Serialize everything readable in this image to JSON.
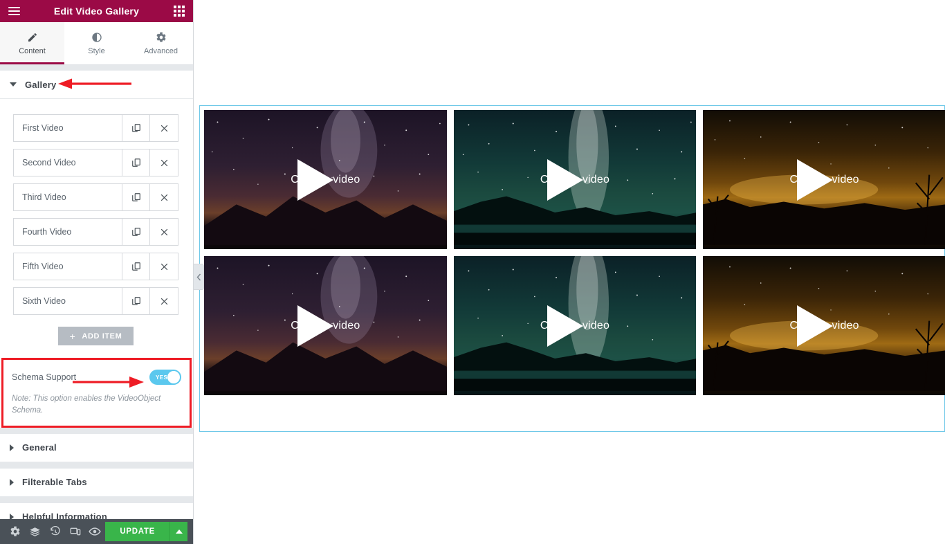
{
  "app": {
    "header": {
      "title": "Edit Video Gallery",
      "menu_icon": "hamburger-icon",
      "apps_icon": "widgets-grid-icon"
    },
    "tabs": [
      {
        "label": "Content",
        "icon": "pencil-icon",
        "active": true
      },
      {
        "label": "Style",
        "icon": "contrast-circle-icon",
        "active": false
      },
      {
        "label": "Advanced",
        "icon": "gear-icon",
        "active": false
      }
    ]
  },
  "panel": {
    "sections": [
      {
        "label": "Gallery",
        "expanded": true
      },
      {
        "label": "General",
        "expanded": false
      },
      {
        "label": "Filterable Tabs",
        "expanded": false
      },
      {
        "label": "Helpful Information",
        "expanded": false
      }
    ],
    "gallery": {
      "items": [
        {
          "title": "First Video"
        },
        {
          "title": "Second Video"
        },
        {
          "title": "Third Video"
        },
        {
          "title": "Fourth Video"
        },
        {
          "title": "Fifth Video"
        },
        {
          "title": "Sixth Video"
        }
      ],
      "add_item_label": "ADD ITEM",
      "add_item_plus": "+",
      "row_duplicate_icon": "duplicate-icon",
      "row_remove_icon": "close-x-icon"
    },
    "schema": {
      "label": "Schema Support",
      "toggle_value": "YES",
      "toggle_on": true,
      "note": "Note: This option enables the VideoObject Schema."
    }
  },
  "footer": {
    "icons": [
      {
        "name": "settings-gear-icon"
      },
      {
        "name": "navigator-layers-icon"
      },
      {
        "name": "history-clock-icon"
      },
      {
        "name": "responsive-mode-icon"
      },
      {
        "name": "preview-eye-icon"
      }
    ],
    "update_label": "UPDATE",
    "update_caret_icon": "caret-up-icon"
  },
  "canvas": {
    "collapse_handle_icon": "chevron-left-icon",
    "videos": [
      {
        "label": "Choose video",
        "theme": "purple-mountain-milkyway"
      },
      {
        "label": "Choose video",
        "theme": "teal-lake-milkyway"
      },
      {
        "label": "Choose video",
        "theme": "amber-trees-night"
      },
      {
        "label": "Choose video",
        "theme": "purple-mountain-milkyway"
      },
      {
        "label": "Choose video",
        "theme": "teal-lake-milkyway"
      },
      {
        "label": "Choose video",
        "theme": "amber-trees-night"
      }
    ]
  },
  "colors": {
    "brand_maroon": "#9b0a46",
    "toggle_cyan": "#5bc8ee",
    "update_green": "#39b54a",
    "annotation_red": "#ee1c25",
    "selection_blue": "#6ec8e8",
    "footer_dark": "#4a5158"
  }
}
